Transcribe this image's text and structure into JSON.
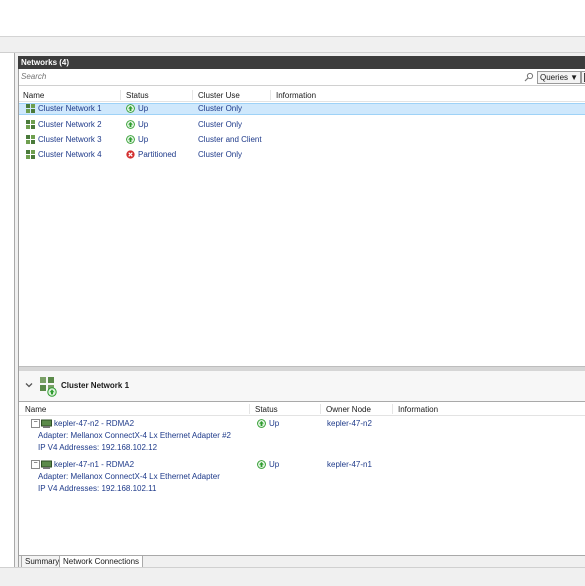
{
  "pane": {
    "title": "Networks (4)"
  },
  "search": {
    "placeholder": "Search"
  },
  "toolbar": {
    "queries_label": "Queries"
  },
  "columns": {
    "name": "Name",
    "status": "Status",
    "cluster_use": "Cluster Use",
    "information": "Information"
  },
  "networks": [
    {
      "name": "Cluster Network 1",
      "status": "Up",
      "cluster_use": "Cluster Only"
    },
    {
      "name": "Cluster Network 2",
      "status": "Up",
      "cluster_use": "Cluster Only"
    },
    {
      "name": "Cluster Network 3",
      "status": "Up",
      "cluster_use": "Cluster and Client"
    },
    {
      "name": "Cluster Network 4",
      "status": "Partitioned",
      "cluster_use": "Cluster Only"
    }
  ],
  "detail": {
    "title": "Cluster Network 1",
    "columns": {
      "name": "Name",
      "status": "Status",
      "owner_node": "Owner Node",
      "information": "Information"
    },
    "connections": [
      {
        "name": "kepler-47-n2 - RDMA2",
        "adapter": "Adapter: Mellanox ConnectX-4 Lx Ethernet Adapter #2",
        "ip": "IP V4 Addresses: 192.168.102.12",
        "status": "Up",
        "owner": "kepler-47-n2"
      },
      {
        "name": "kepler-47-n1 - RDMA2",
        "adapter": "Adapter: Mellanox ConnectX-4 Lx Ethernet Adapter",
        "ip": "IP V4 Addresses: 192.168.102.11",
        "status": "Up",
        "owner": "kepler-47-n1"
      }
    ]
  },
  "tabs": {
    "summary": "Summary",
    "network_connections": "Network Connections"
  },
  "colors": {
    "header_bg": "#3c3c3c",
    "selected_bg": "#cfe8fc",
    "up_green": "#2e9c2e",
    "partitioned_red": "#d32f2f",
    "link_blue": "#1e3a8a"
  },
  "icons": {
    "network": "network-icon",
    "up": "status-up-icon",
    "partitioned": "status-error-icon",
    "search": "search-icon",
    "save": "save-icon"
  }
}
